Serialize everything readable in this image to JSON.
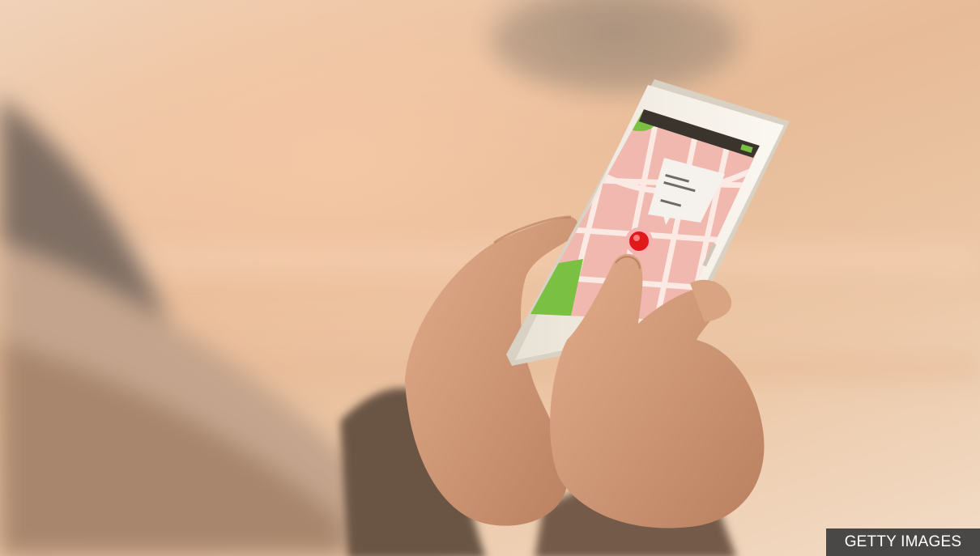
{
  "image": {
    "subject": "hands-holding-smartphone-map",
    "credit": "GETTY IMAGES"
  },
  "colors": {
    "background": "#ecc6a4",
    "sleeve": "#6b5444",
    "skin": "#d7a07e",
    "phone_body": "#f1ece2",
    "map_pink": "#f0b8ae",
    "map_green": "#7ac043",
    "pin_red": "#e01a1a"
  },
  "icons": [
    "map-pin-icon",
    "signal-icon",
    "battery-icon"
  ]
}
